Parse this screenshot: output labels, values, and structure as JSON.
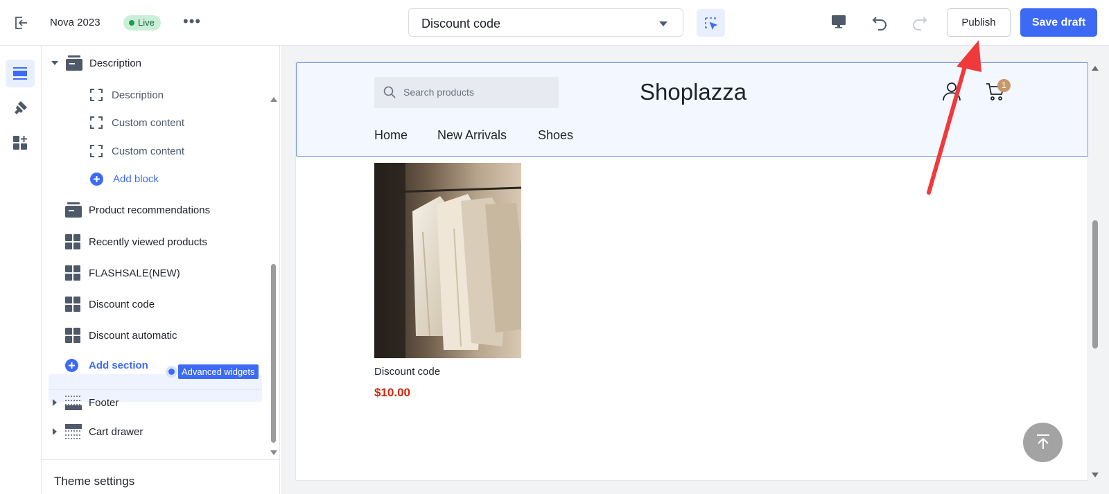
{
  "topbar": {
    "theme_name": "Nova 2023",
    "status": "Live",
    "more": "•••",
    "page_select": "Discount code",
    "publish_label": "Publish",
    "save_label": "Save draft"
  },
  "sidebar": {
    "section_description": "Description",
    "blocks": [
      "Description",
      "Custom content",
      "Custom content"
    ],
    "add_block": "Add block",
    "sections": [
      "Product recommendations",
      "Recently viewed products",
      "FLASHSALE(NEW)",
      "Discount code",
      "Discount automatic"
    ],
    "add_section": "Add section",
    "advanced_widgets": "Advanced widgets",
    "footer": "Footer",
    "cart_drawer": "Cart drawer",
    "theme_settings": "Theme settings"
  },
  "store": {
    "search_placeholder": "Search products",
    "logo": "Shoplazza",
    "cart_count": "1",
    "nav": [
      "Home",
      "New Arrivals",
      "Shoes"
    ],
    "product_name": "Discount code",
    "product_price": "$10.00"
  },
  "colors": {
    "accent": "#3d6af5",
    "live_bg": "#c9efd7",
    "price": "#d6260b",
    "annotation_arrow": "#f0393a"
  }
}
